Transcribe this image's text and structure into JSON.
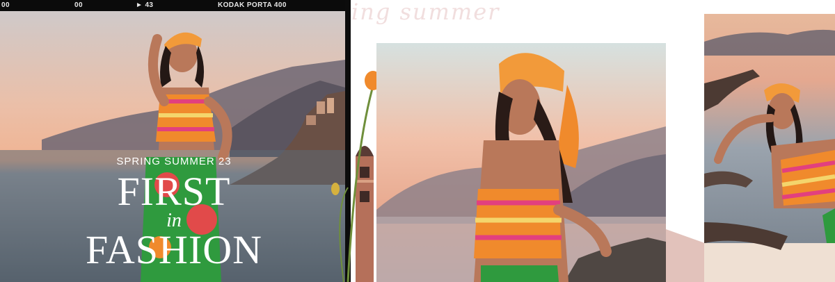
{
  "film_strip": {
    "frame_left": "00",
    "frame_mid": "00",
    "frame_arrow": "► 43",
    "film_name": "KODAK PORTA 400"
  },
  "banner": {
    "season": "SPRING SUMMER 23",
    "headline_line1": "FIRST",
    "headline_connector": "in",
    "headline_line2": "FASHION",
    "script_title": "ing summer"
  },
  "colors": {
    "sky_top": "#d7c4bd",
    "sky_glow": "#f2b79a",
    "sea": "#5e6a74",
    "hills": "#6b6570",
    "top_orange": "#f08a2c",
    "top_pink": "#e2407e",
    "scarf_orange": "#f29a3a",
    "skirt_green": "#2f9a3e",
    "skirt_red": "#e14a4a",
    "script_text": "#f1dede"
  }
}
